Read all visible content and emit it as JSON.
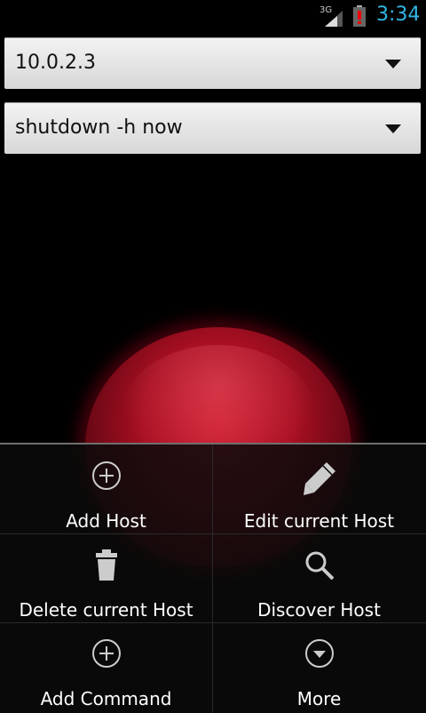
{
  "status_bar": {
    "network": "3G",
    "time": "3:34",
    "accent_color": "#33b5e5"
  },
  "host_spinner": {
    "value": "10.0.2.3"
  },
  "command_spinner": {
    "value": "shutdown -h now"
  },
  "menu": {
    "items": [
      {
        "label": "Add Host",
        "icon": "plus-circle-icon"
      },
      {
        "label": "Edit current Host",
        "icon": "pencil-icon"
      },
      {
        "label": "Delete current Host",
        "icon": "trash-icon"
      },
      {
        "label": "Discover Host",
        "icon": "search-icon"
      },
      {
        "label": "Add Command",
        "icon": "plus-circle-icon"
      },
      {
        "label": "More",
        "icon": "chevron-down-circle-icon"
      }
    ]
  },
  "colors": {
    "button_red": "#b8142a",
    "spinner_bg": "#e6e6e6",
    "menu_bg": "#0a0a0a"
  }
}
